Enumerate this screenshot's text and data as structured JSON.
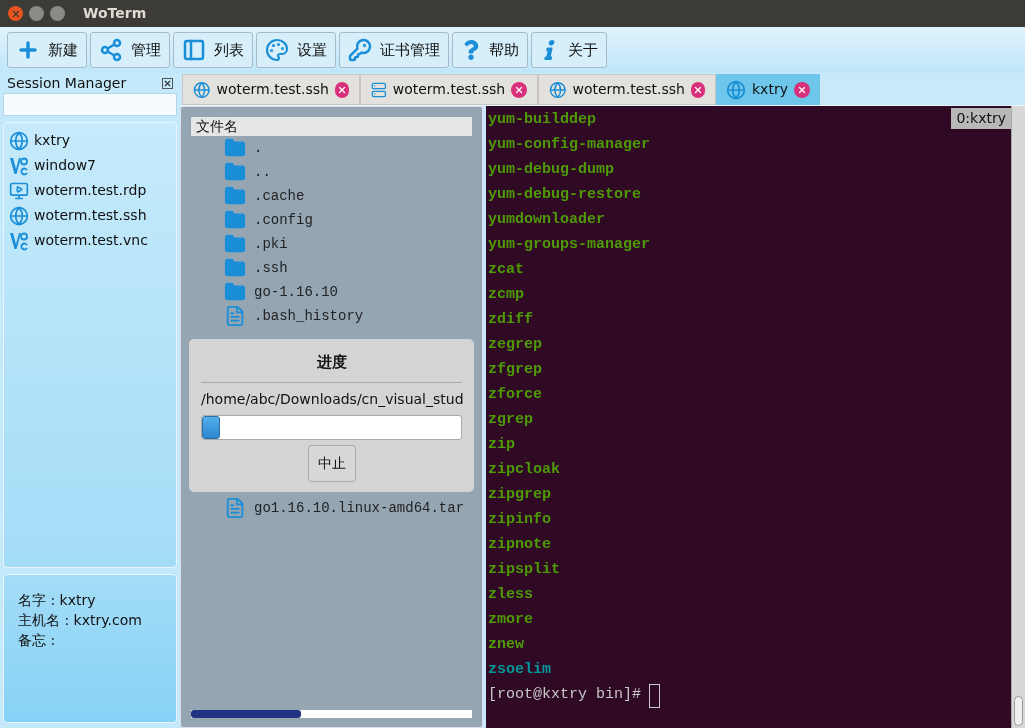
{
  "window": {
    "title": "WoTerm"
  },
  "toolbar": [
    {
      "kind": "new",
      "label": "新建"
    },
    {
      "kind": "manage",
      "label": "管理"
    },
    {
      "kind": "list",
      "label": "列表"
    },
    {
      "kind": "settings",
      "label": "设置"
    },
    {
      "kind": "certs",
      "label": "证书管理"
    },
    {
      "kind": "help",
      "label": "帮助"
    },
    {
      "kind": "about",
      "label": "关于"
    }
  ],
  "session_manager": {
    "title": "Session Manager",
    "items": [
      {
        "kind": "ssh",
        "label": "kxtry"
      },
      {
        "kind": "vnc",
        "label": "window7"
      },
      {
        "kind": "rdp",
        "label": "woterm.test.rdp"
      },
      {
        "kind": "ssh",
        "label": "woterm.test.ssh"
      },
      {
        "kind": "vnc",
        "label": "woterm.test.vnc"
      }
    ],
    "details": [
      "名字 : kxtry",
      "主机名 : kxtry.com",
      "备忘 :"
    ]
  },
  "tabs": [
    {
      "kind": "ssh",
      "label": "woterm.test.ssh",
      "selected": false
    },
    {
      "kind": "server",
      "label": "woterm.test.ssh",
      "selected": false
    },
    {
      "kind": "ssh",
      "label": "woterm.test.ssh",
      "selected": false
    },
    {
      "kind": "ssh",
      "label": "kxtry",
      "selected": true
    }
  ],
  "file_list": {
    "header": "文件名",
    "items": [
      {
        "kind": "folder",
        "name": "."
      },
      {
        "kind": "folder",
        "name": ".."
      },
      {
        "kind": "folder",
        "name": ".cache"
      },
      {
        "kind": "folder",
        "name": ".config"
      },
      {
        "kind": "folder",
        "name": ".pki"
      },
      {
        "kind": "folder",
        "name": ".ssh"
      },
      {
        "kind": "folder",
        "name": "go-1.16.10"
      },
      {
        "kind": "file",
        "name": ".bash_history"
      }
    ],
    "items_below_dialog": [
      {
        "kind": "file",
        "name": "go1.16.10.linux-amd64.tar"
      }
    ],
    "transfer": {
      "level": 0.39
    }
  },
  "progress_dialog": {
    "title": "进度",
    "path": "/home/abc/Downloads/cn_visual_stud",
    "level": 0.07,
    "button": "中止"
  },
  "terminal": {
    "session_label": "0:kxtry",
    "lines": [
      {
        "kind": "exec",
        "text": "yum-builddep"
      },
      {
        "kind": "exec",
        "text": "yum-config-manager"
      },
      {
        "kind": "exec",
        "text": "yum-debug-dump"
      },
      {
        "kind": "exec",
        "text": "yum-debug-restore"
      },
      {
        "kind": "exec",
        "text": "yumdownloader"
      },
      {
        "kind": "exec",
        "text": "yum-groups-manager"
      },
      {
        "kind": "exec",
        "text": "zcat"
      },
      {
        "kind": "exec",
        "text": "zcmp"
      },
      {
        "kind": "exec",
        "text": "zdiff"
      },
      {
        "kind": "exec",
        "text": "zegrep"
      },
      {
        "kind": "exec",
        "text": "zfgrep"
      },
      {
        "kind": "exec",
        "text": "zforce"
      },
      {
        "kind": "exec",
        "text": "zgrep"
      },
      {
        "kind": "exec",
        "text": "zip"
      },
      {
        "kind": "exec",
        "text": "zipcloak"
      },
      {
        "kind": "exec",
        "text": "zipgrep"
      },
      {
        "kind": "exec",
        "text": "zipinfo"
      },
      {
        "kind": "exec",
        "text": "zipnote"
      },
      {
        "kind": "exec",
        "text": "zipsplit"
      },
      {
        "kind": "exec",
        "text": "zless"
      },
      {
        "kind": "exec",
        "text": "zmore"
      },
      {
        "kind": "exec",
        "text": "znew"
      },
      {
        "kind": "link",
        "text": "zsoelim"
      },
      {
        "kind": "prompt",
        "text": "[root@kxtry bin]#"
      }
    ]
  }
}
